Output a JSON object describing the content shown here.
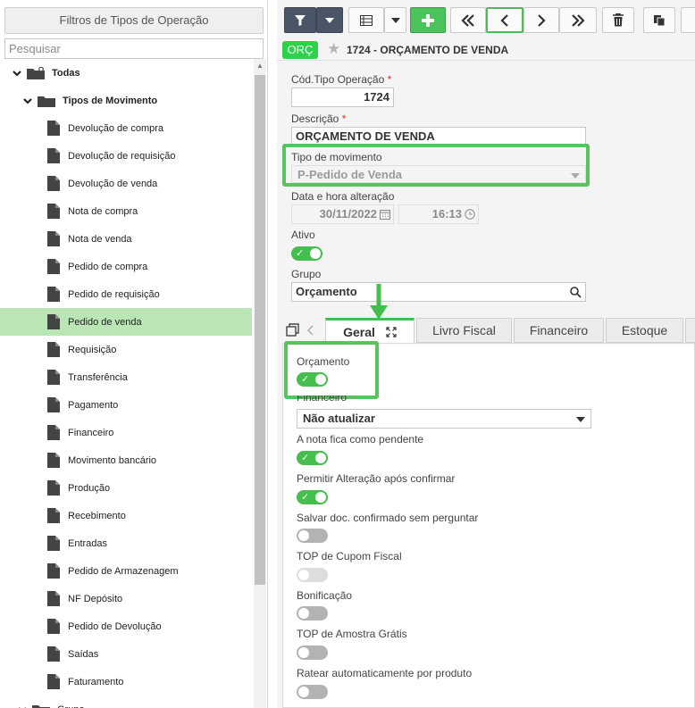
{
  "left_panel": {
    "title": "Filtros de Tipos de Operação",
    "search_placeholder": "Pesquisar",
    "tree_root": "Todas",
    "tree_group": "Tipos de Movimento",
    "items": [
      "Devolução de compra",
      "Devolução de requisição",
      "Devolução de venda",
      "Nota de compra",
      "Nota de venda",
      "Pedido de compra",
      "Pedido de requisição",
      "Pedido de venda",
      "Requisição",
      "Transferência",
      "Pagamento",
      "Financeiro",
      "Movimento bancário",
      "Produção",
      "Recebimento",
      "Entradas",
      "Pedido de Armazenagem",
      "NF Depósito",
      "Pedido de Devolução",
      "Saídas",
      "Faturamento"
    ],
    "selected_item": "Pedido de venda",
    "next_group": "Grupo"
  },
  "toolbar": {
    "buttons": [
      "filter-icon",
      "dropdown-caret-icon",
      "grid-icon",
      "dropdown-caret-icon",
      "add-icon",
      "first-record-icon",
      "previous-record-icon",
      "next-record-icon",
      "last-record-icon",
      "delete-icon",
      "copy-icon"
    ]
  },
  "record": {
    "badge": "ORÇ",
    "title": "1724 - ORÇAMENTO DE VENDA"
  },
  "form": {
    "cod_label": "Cód.Tipo Operação",
    "cod_value": "1724",
    "required_mark": "*",
    "desc_label": "Descrição",
    "desc_value": "ORÇAMENTO DE VENDA",
    "tipo_label": "Tipo de movimento",
    "tipo_value": "P-Pedido de Venda",
    "data_label": "Data e hora alteração",
    "date_value": "30/11/2022",
    "time_value": "16:13",
    "ativo_label": "Ativo",
    "ativo_on": true,
    "grupo_label": "Grupo",
    "grupo_value": "Orçamento"
  },
  "tabs": {
    "items": [
      "Geral",
      "Livro Fiscal",
      "Financeiro",
      "Estoque"
    ],
    "active": "Geral"
  },
  "geral": {
    "orcamento_label": "Orçamento",
    "orcamento_on": true,
    "financeiro_label": "Financeiro",
    "financeiro_value": "Não atualizar",
    "pendente_label": "A nota fica como pendente",
    "pendente_on": true,
    "permitir_label": "Permitir Alteração após confirmar",
    "permitir_on": true,
    "salvar_label": "Salvar doc. confirmado sem perguntar",
    "salvar_on": false,
    "cupom_label": "TOP de Cupom Fiscal",
    "cupom_on": false,
    "bonificacao_label": "Bonificação",
    "bonificacao_on": false,
    "amostra_label": "TOP de Amostra Grátis",
    "amostra_on": false,
    "ratear_label": "Ratear automaticamente por produto",
    "ratear_on": false
  },
  "colors": {
    "accent_green": "#46bd4f",
    "highlight_green": "#5bc260",
    "selected_row": "#b9e6b4",
    "badge_green": "#2ed14a"
  }
}
